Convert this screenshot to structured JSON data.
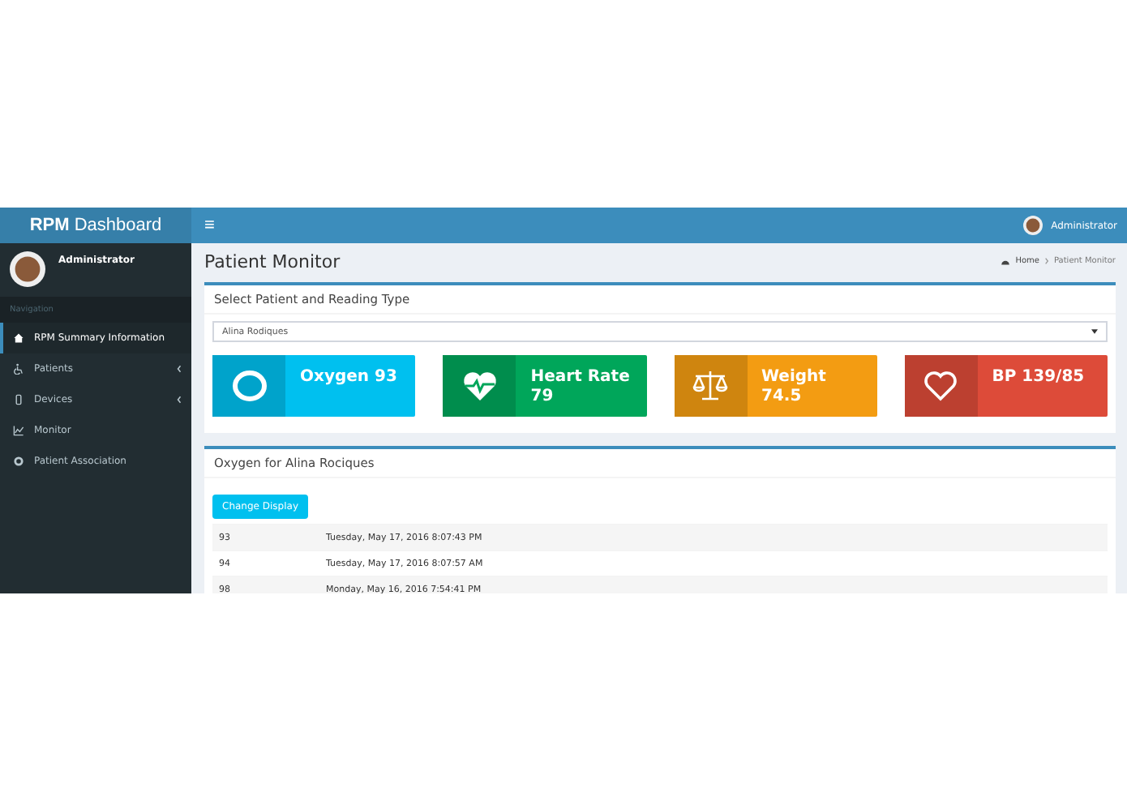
{
  "header": {
    "logo_bold": "RPM",
    "logo_rest": "Dashboard",
    "menu_glyph": "≡",
    "user": "Administrator"
  },
  "sidebar": {
    "user": "Administrator",
    "section": "Navigation",
    "items": [
      {
        "label": "RPM Summary Information",
        "kind": "home",
        "selected": true,
        "expandable": false
      },
      {
        "label": "Patients",
        "kind": "wheelchair",
        "selected": false,
        "expandable": true
      },
      {
        "label": "Devices",
        "kind": "device",
        "selected": false,
        "expandable": true
      },
      {
        "label": "Monitor",
        "kind": "chart",
        "selected": false,
        "expandable": false
      },
      {
        "label": "Patient Association",
        "kind": "gear",
        "selected": false,
        "expandable": false
      }
    ]
  },
  "page": {
    "title": "Patient Monitor",
    "breadcrumb": [
      "Home",
      "Patient Monitor"
    ]
  },
  "selector": {
    "title": "Select Patient and Reading Type",
    "value": "Alina Rodiques"
  },
  "tiles": [
    {
      "kind": "oxygen",
      "text": "Oxygen 93",
      "color": "#00c0ef"
    },
    {
      "kind": "heart-rate",
      "text": "Heart Rate 79",
      "color": "#00a65a"
    },
    {
      "kind": "weight",
      "text": "Weight 74.5",
      "color": "#f39c12"
    },
    {
      "kind": "bp",
      "text": "BP 139/85",
      "color": "#dd4b39"
    }
  ],
  "readings": {
    "title": "Oxygen for Alina Rociques",
    "button": "Change Display",
    "rows": [
      {
        "value": "93",
        "time": "Tuesday, May 17, 2016 8:07:43 PM"
      },
      {
        "value": "94",
        "time": "Tuesday, May 17, 2016 8:07:57 AM"
      },
      {
        "value": "98",
        "time": "Monday, May 16, 2016 7:54:41 PM"
      }
    ]
  }
}
